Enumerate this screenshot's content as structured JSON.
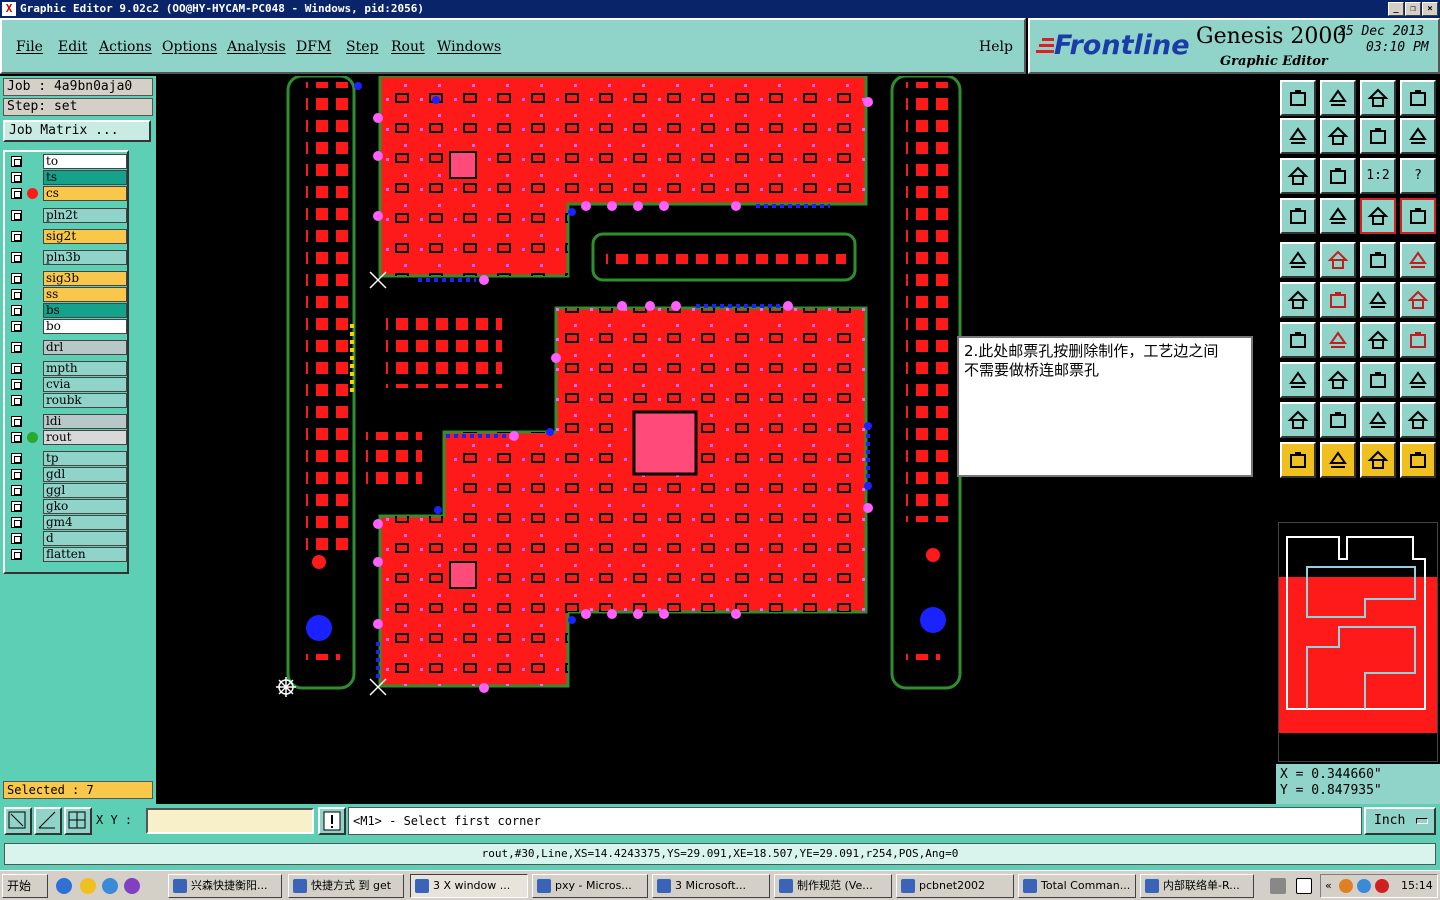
{
  "window": {
    "title": "Graphic Editor 9.02c2 (OO@HY-HYCAM-PC048 - Windows, pid:2056)",
    "controls": [
      "_",
      "❐",
      "×"
    ]
  },
  "menu": [
    "File",
    "Edit",
    "Actions",
    "Options",
    "Analysis",
    "DFM",
    "Step",
    "Rout",
    "Windows"
  ],
  "help_label": "Help",
  "brand": {
    "logo": "Frontline",
    "product": "Genesis 2000",
    "subtitle": "Graphic Editor",
    "date": "25 Dec 2013",
    "time": "03:10 PM"
  },
  "job": "Job : 4a9bn0aja0",
  "step": "Step: set",
  "job_matrix_label": "Job Matrix ...",
  "layers": [
    {
      "name": "to",
      "bg": "#ffffff",
      "dot": ""
    },
    {
      "name": "ts",
      "bg": "#15a28a",
      "dot": ""
    },
    {
      "name": "cs",
      "bg": "#f9c84a",
      "dot": "#ff1a1a"
    },
    {
      "name": "pln2t",
      "bg": "#8fd3c9",
      "dot": ""
    },
    {
      "name": "sig2t",
      "bg": "#f9c84a",
      "dot": ""
    },
    {
      "name": "pln3b",
      "bg": "#8fd3c9",
      "dot": ""
    },
    {
      "name": "sig3b",
      "bg": "#f9c84a",
      "dot": ""
    },
    {
      "name": "ss",
      "bg": "#f9c84a",
      "dot": ""
    },
    {
      "name": "bs",
      "bg": "#15a28a",
      "dot": ""
    },
    {
      "name": "bo",
      "bg": "#ffffff",
      "dot": ""
    },
    {
      "name": "drl",
      "bg": "#b8c8c8",
      "dot": ""
    },
    {
      "name": "mpth",
      "bg": "#8fd3c9",
      "dot": ""
    },
    {
      "name": "cvia",
      "bg": "#8fd3c9",
      "dot": ""
    },
    {
      "name": "roubk",
      "bg": "#8fd3c9",
      "dot": ""
    },
    {
      "name": "ldi",
      "bg": "#b8c8c8",
      "dot": ""
    },
    {
      "name": "rout",
      "bg": "#d8d8d8",
      "dot": "#2aa82a"
    },
    {
      "name": "tp",
      "bg": "#8fd3c9",
      "dot": ""
    },
    {
      "name": "gdl",
      "bg": "#8fd3c9",
      "dot": ""
    },
    {
      "name": "ggl",
      "bg": "#8fd3c9",
      "dot": ""
    },
    {
      "name": "gko",
      "bg": "#8fd3c9",
      "dot": ""
    },
    {
      "name": "gm4",
      "bg": "#8fd3c9",
      "dot": ""
    },
    {
      "name": "d",
      "bg": "#8fd3c9",
      "dot": ""
    },
    {
      "name": "flatten",
      "bg": "#8fd3c9",
      "dot": ""
    }
  ],
  "selected": "Selected : 7",
  "annotation": {
    "line1": "2.此处邮票孔按删除制作，工艺边之间",
    "line2": "不需要做桥连邮票孔"
  },
  "toolbar_glyphs": {
    "one_to_two": "1:2",
    "question": "?"
  },
  "coords": {
    "x": "X = 0.344660\"",
    "y": "Y = 0.847935\""
  },
  "command": {
    "xy_label": "X Y :",
    "xy_value": "",
    "prompt": "<M1> - Select first corner",
    "units": "Inch"
  },
  "status_line": "rout,#30,Line,XS=14.4243375,YS=29.091,XE=18.507,YE=29.091,r254,POS,Ang=0",
  "taskbar": {
    "start": "开始",
    "tasks": [
      "兴森快捷衡阳...",
      "快捷方式 到 get",
      "3 X window ...",
      "pxy - Micros...",
      "3 Microsoft...",
      "制作规范 (Ve...",
      "pcbnet2002",
      "Total Comman...",
      "内部联络单-R..."
    ],
    "clock": "15:14"
  }
}
